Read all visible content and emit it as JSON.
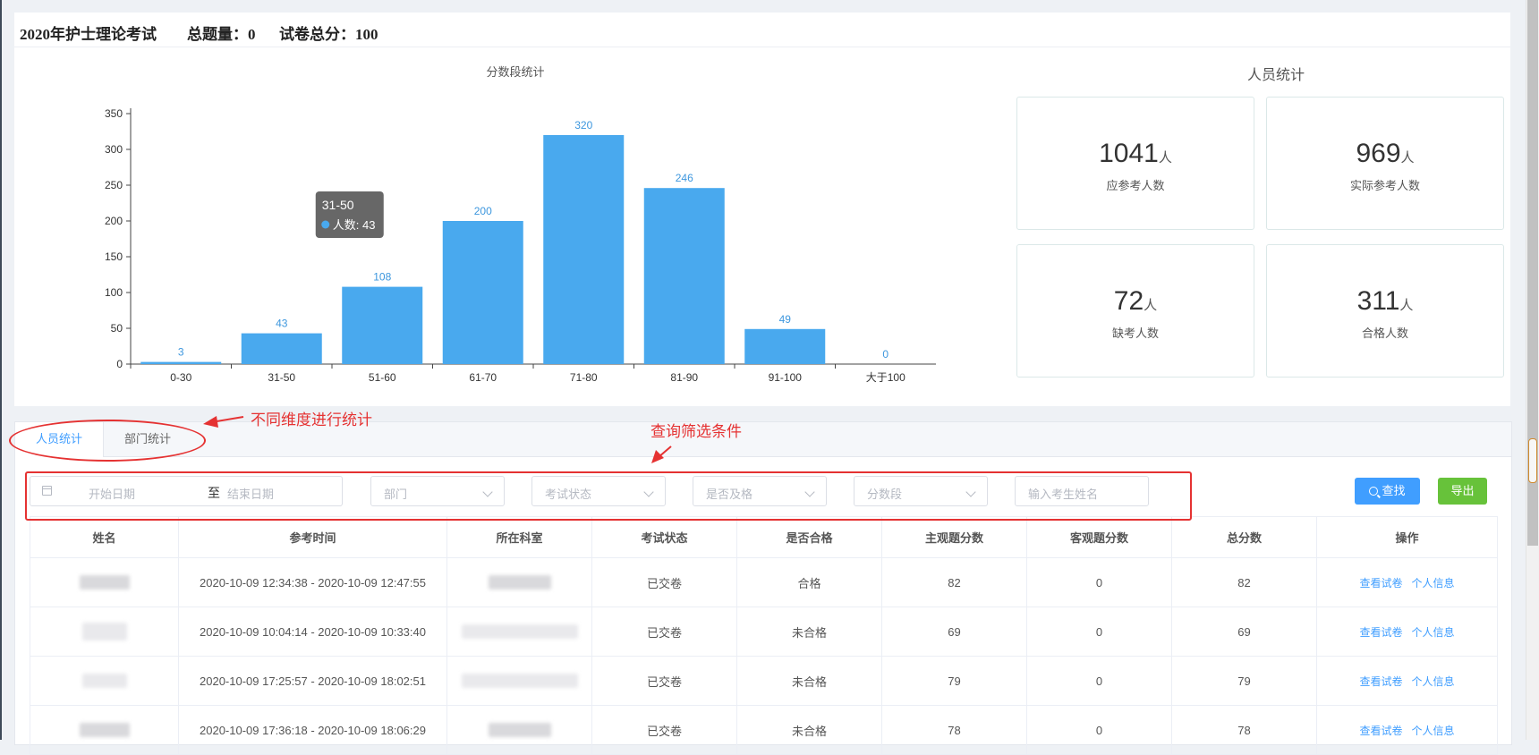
{
  "header": {
    "exam_name": "2020年护士理论考试",
    "total_questions": "总题量：0",
    "total_score": "试卷总分：100"
  },
  "chart_data": {
    "type": "bar",
    "title": "分数段统计",
    "categories": [
      "0-30",
      "31-50",
      "51-60",
      "61-70",
      "71-80",
      "81-90",
      "91-100",
      "大于100"
    ],
    "series": [
      {
        "name": "人数",
        "values": [
          3,
          43,
          108,
          200,
          320,
          246,
          49,
          0
        ]
      }
    ],
    "ylim": [
      0,
      350
    ],
    "yticks": [
      0,
      50,
      100,
      150,
      200,
      250,
      300,
      350
    ],
    "xlabel": "",
    "ylabel": "",
    "bar_color": "#49a9ee",
    "label_color": "#3d97de",
    "grid": false,
    "tooltip": {
      "category": "31-50",
      "text": "人数: 43"
    }
  },
  "stats": {
    "title": "人员统计",
    "unit": "人",
    "cards": [
      {
        "value": "1041",
        "label": "应参考人数"
      },
      {
        "value": "969",
        "label": "实际参考人数"
      },
      {
        "value": "72",
        "label": "缺考人数"
      },
      {
        "value": "311",
        "label": "合格人数"
      }
    ]
  },
  "tabs": [
    {
      "label": "人员统计",
      "active": true
    },
    {
      "label": "部门统计",
      "active": false
    }
  ],
  "filters": {
    "start_date_placeholder": "开始日期",
    "range_separator": "至",
    "end_date_placeholder": "结束日期",
    "department_placeholder": "部门",
    "exam_status_placeholder": "考试状态",
    "pass_placeholder": "是否及格",
    "score_range_placeholder": "分数段",
    "name_placeholder": "输入考生姓名",
    "search_label": "查找",
    "export_label": "导出"
  },
  "table": {
    "columns": [
      "姓名",
      "参考时间",
      "所在科室",
      "考试状态",
      "是否合格",
      "主观题分数",
      "客观题分数",
      "总分数",
      "操作"
    ],
    "rows": [
      {
        "time": "2020-10-09 12:34:38 - 2020-10-09 12:47:55",
        "status": "已交卷",
        "pass": "合格",
        "subjective": "82",
        "objective": "0",
        "total": "82"
      },
      {
        "time": "2020-10-09 10:04:14 - 2020-10-09 10:33:40",
        "status": "已交卷",
        "pass": "未合格",
        "subjective": "69",
        "objective": "0",
        "total": "69"
      },
      {
        "time": "2020-10-09 17:25:57 - 2020-10-09 18:02:51",
        "status": "已交卷",
        "pass": "未合格",
        "subjective": "79",
        "objective": "0",
        "total": "79"
      },
      {
        "time": "2020-10-09 17:36:18 - 2020-10-09 18:06:29",
        "status": "已交卷",
        "pass": "未合格",
        "subjective": "78",
        "objective": "0",
        "total": "78"
      }
    ],
    "actions": {
      "view": "查看试卷",
      "info": "个人信息"
    }
  },
  "annotations": {
    "dimension_note": "不同维度进行统计",
    "filter_note": "查询筛选条件",
    "color": "#e53232"
  }
}
